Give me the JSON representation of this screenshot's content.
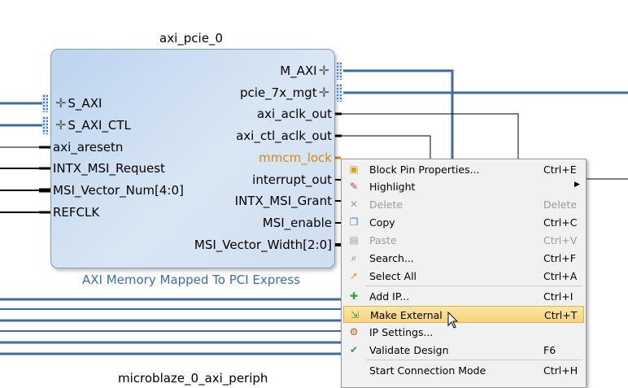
{
  "block": {
    "title": "axi_pcie_0",
    "subtitle": "AXI Memory Mapped To PCI Express",
    "left_pins": [
      "S_AXI",
      "S_AXI_CTL",
      "axi_aresetn",
      "INTX_MSI_Request",
      "MSI_Vector_Num[4:0]",
      "REFCLK"
    ],
    "right_pins": [
      "M_AXI",
      "pcie_7x_mgt",
      "axi_aclk_out",
      "axi_ctl_aclk_out",
      "mmcm_lock",
      "interrupt_out",
      "INTX_MSI_Grant",
      "MSI_enable",
      "MSI_Vector_Width[2:0]"
    ],
    "bus_plus_glyph": "✛"
  },
  "bottom_label": "microblaze_0_axi_periph",
  "context_menu": {
    "items": [
      {
        "label": "Block Pin Properties...",
        "shortcut": "Ctrl+E",
        "icon": "properties-icon",
        "glyph": "▣",
        "color": "#d9a020"
      },
      {
        "label": "Highlight",
        "shortcut": "",
        "icon": "highlight-icon",
        "glyph": "✎",
        "color": "#c04040",
        "submenu": "▶"
      },
      {
        "label": "Delete",
        "shortcut": "Delete",
        "icon": "delete-icon",
        "glyph": "✕",
        "color": "#a0a0a0",
        "disabled": true
      },
      {
        "label": "Copy",
        "shortcut": "Ctrl+C",
        "icon": "copy-icon",
        "glyph": "❐",
        "color": "#4a7ab8"
      },
      {
        "label": "Paste",
        "shortcut": "Ctrl+V",
        "icon": "paste-icon",
        "glyph": "▤",
        "color": "#a0a0a0",
        "disabled": true
      },
      {
        "label": "Search...",
        "shortcut": "Ctrl+F",
        "icon": "search-icon",
        "glyph": "⌕",
        "color": "#2a70c0"
      },
      {
        "label": "Select All",
        "shortcut": "Ctrl+A",
        "icon": "select-all-icon",
        "glyph": "➚",
        "color": "#d9a020"
      },
      {
        "label": "Add IP...",
        "shortcut": "Ctrl+I",
        "icon": "add-ip-icon",
        "glyph": "✚",
        "color": "#3a9a3a"
      },
      {
        "label": "Make External",
        "shortcut": "Ctrl+T",
        "icon": "make-external-icon",
        "glyph": "⇲",
        "color": "#3a9a3a",
        "highlighted": true
      },
      {
        "label": "IP Settings...",
        "shortcut": "",
        "icon": "ip-settings-icon",
        "glyph": "⚙",
        "color": "#c06020"
      },
      {
        "label": "Validate Design",
        "shortcut": "F6",
        "icon": "validate-icon",
        "glyph": "✔",
        "color": "#3a9a3a"
      },
      {
        "label": "Start Connection Mode",
        "shortcut": "Ctrl+H",
        "icon": "",
        "glyph": "",
        "color": "#000000"
      }
    ]
  },
  "colors": {
    "bus_line": "#3f6d9e",
    "signal_line": "#000000",
    "highlight_label": "#d08b17",
    "subtitle": "#3a6ea5"
  }
}
